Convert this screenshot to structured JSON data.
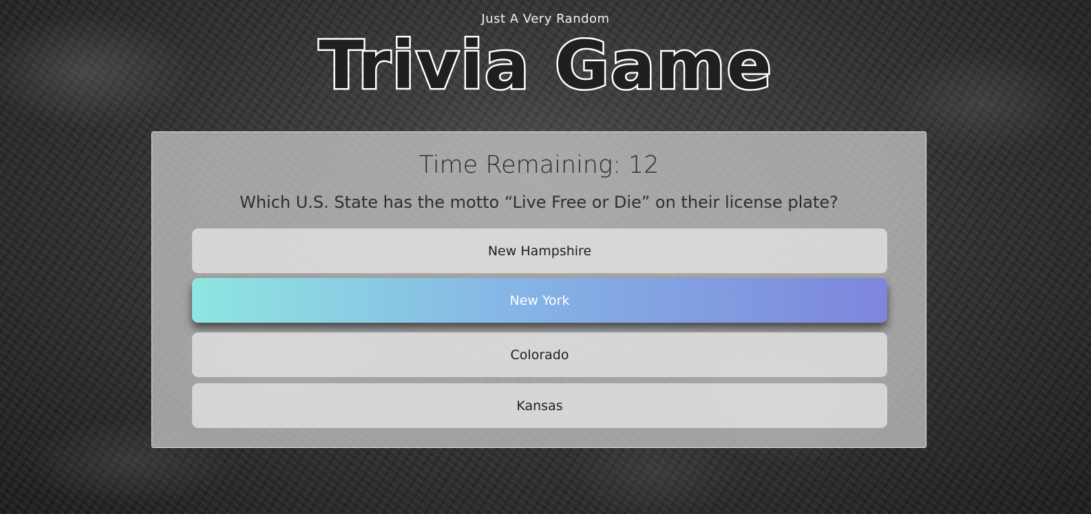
{
  "header": {
    "subtitle": "Just A Very Random",
    "title": "Trivia Game"
  },
  "game": {
    "timer_label": "Time Remaining: 12",
    "question": "Which U.S. State has the motto “Live Free or Die” on their license plate?",
    "answers": [
      {
        "label": "New Hampshire",
        "state": "default"
      },
      {
        "label": "New York",
        "state": "hovered"
      },
      {
        "label": "Colorado",
        "state": "default"
      },
      {
        "label": "Kansas",
        "state": "default"
      }
    ]
  },
  "colors": {
    "card_background": "#cdcdcd",
    "answer_background": "#ebebeb",
    "hover_gradient_start": "#8ee6e1",
    "hover_gradient_end": "#7d86dc",
    "title_color": "#ffffff",
    "text_color": "#2a2a2a"
  }
}
